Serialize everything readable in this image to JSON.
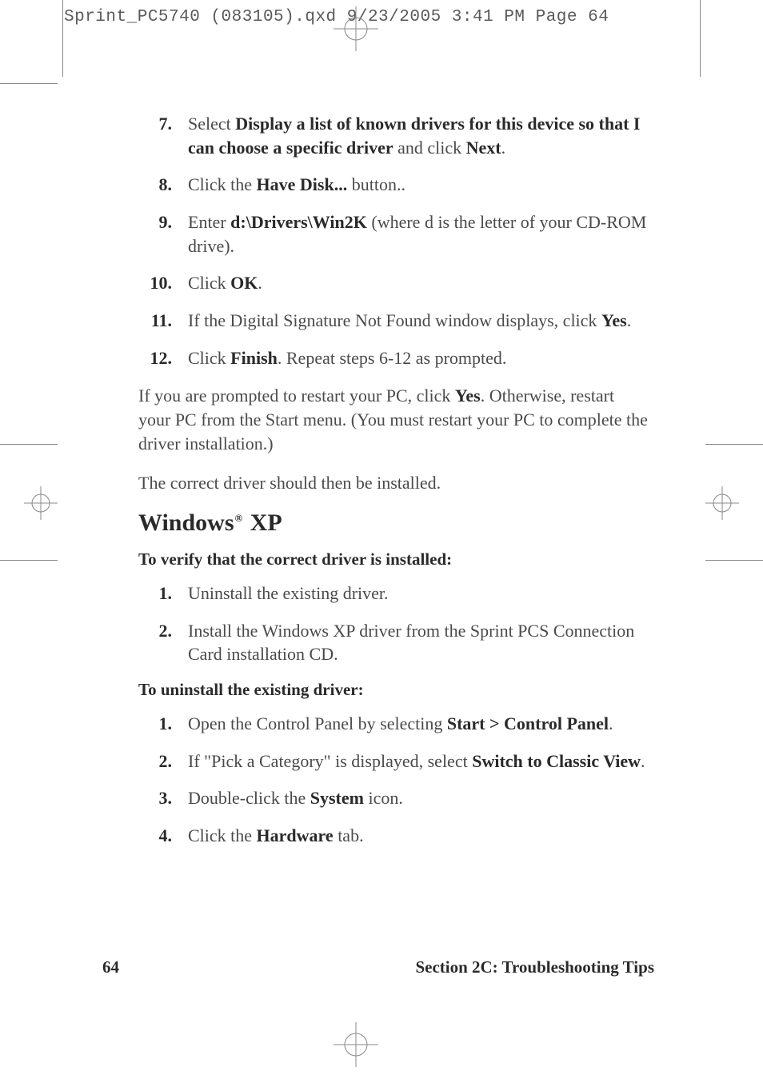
{
  "crop_header": "Sprint_PC5740 (083105).qxd  9/23/2005  3:41 PM  Page 64",
  "list_a": [
    {
      "num": "7.",
      "parts": [
        "Select ",
        {
          "b": "Display a list of known drivers for this device so that I can choose a specific driver"
        },
        " and click ",
        {
          "b": "Next"
        },
        "."
      ]
    },
    {
      "num": "8.",
      "parts": [
        "Click the ",
        {
          "b": "Have Disk..."
        },
        " button.."
      ]
    },
    {
      "num": "9.",
      "parts": [
        "Enter ",
        {
          "b": "d:\\Drivers\\Win2K"
        },
        " (where d is the letter of your CD-ROM drive)."
      ]
    },
    {
      "num": "10.",
      "parts": [
        "Click ",
        {
          "b": "OK"
        },
        "."
      ]
    },
    {
      "num": "11.",
      "parts": [
        "If the Digital Signature Not Found window displays, click ",
        {
          "b": "Yes"
        },
        "."
      ]
    },
    {
      "num": "12.",
      "parts": [
        "Click ",
        {
          "b": "Finish"
        },
        ". Repeat steps 6-12 as prompted."
      ]
    }
  ],
  "para1_parts": [
    "If you are prompted to restart your PC, click ",
    {
      "b": "Yes"
    },
    ". Otherwise, restart your PC from the Start menu. (You must restart your PC to complete the driver installation.)"
  ],
  "para2": "The correct driver should then be installed.",
  "heading": {
    "pre": "Windows",
    "sup": "®",
    "post": " XP"
  },
  "sub1": "To verify that the correct driver is installed:",
  "list_b": [
    {
      "num": "1.",
      "parts": [
        "Uninstall the existing driver."
      ]
    },
    {
      "num": "2.",
      "parts": [
        "Install the Windows XP driver from the Sprint PCS Connection Card installation CD."
      ]
    }
  ],
  "sub2": "To uninstall the existing driver:",
  "list_c": [
    {
      "num": "1.",
      "parts": [
        "Open the Control Panel by selecting ",
        {
          "b": "Start > Control Panel"
        },
        "."
      ]
    },
    {
      "num": "2.",
      "parts": [
        "If \"Pick a Category\" is displayed, select ",
        {
          "b": "Switch to Classic View"
        },
        "."
      ]
    },
    {
      "num": "3.",
      "parts": [
        "Double-click the ",
        {
          "b": "System"
        },
        " icon."
      ]
    },
    {
      "num": "4.",
      "parts": [
        "Click the ",
        {
          "b": "Hardware"
        },
        " tab."
      ]
    }
  ],
  "footer": {
    "page": "64",
    "section": "Section 2C: Troubleshooting Tips"
  }
}
